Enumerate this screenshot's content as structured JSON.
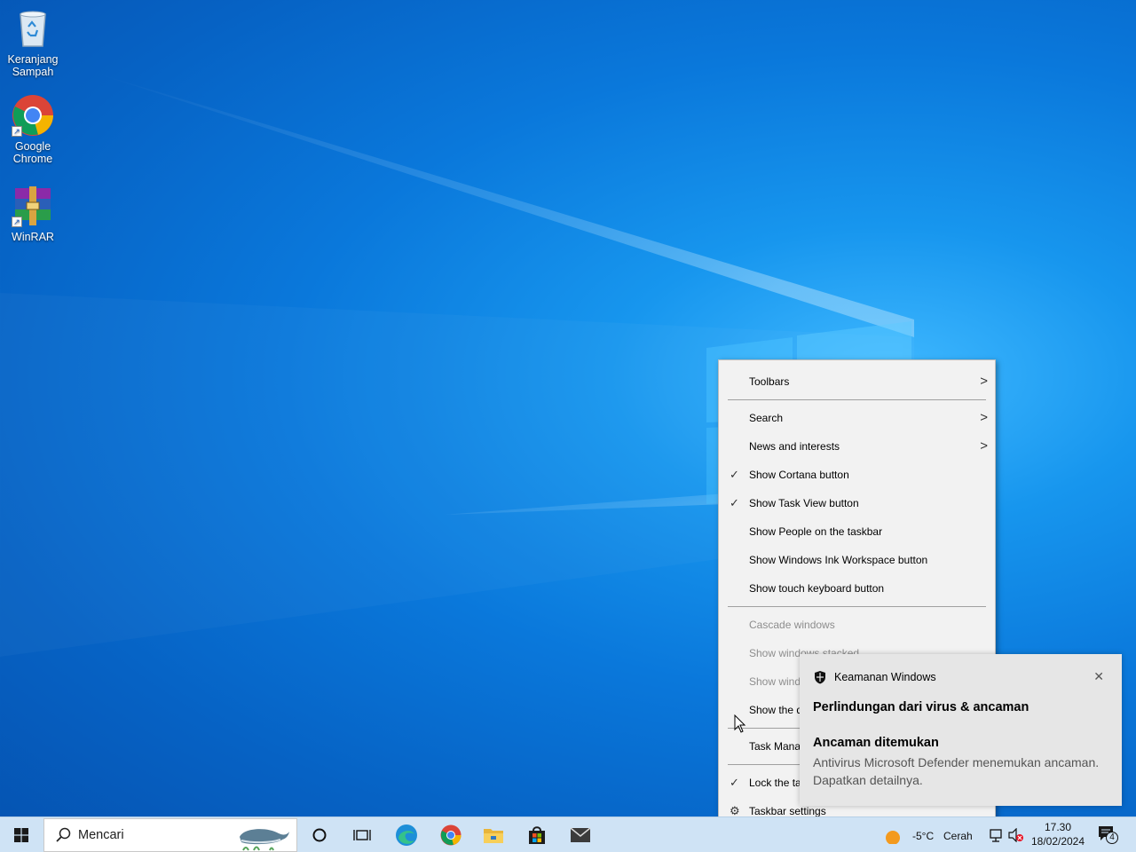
{
  "desktop": {
    "icons": [
      {
        "label": "Keranjang Sampah",
        "icon": "recycle-bin-icon"
      },
      {
        "label": "Google Chrome",
        "icon": "chrome-icon"
      },
      {
        "label": "WinRAR",
        "icon": "winrar-icon"
      }
    ]
  },
  "context_menu": {
    "items": [
      {
        "label": "Toolbars",
        "submenu": true,
        "checked": false,
        "enabled": true
      },
      {
        "label": "Search",
        "submenu": true,
        "checked": false,
        "enabled": true
      },
      {
        "label": "News and interests",
        "submenu": true,
        "checked": false,
        "enabled": true
      },
      {
        "label": "Show Cortana button",
        "submenu": false,
        "checked": true,
        "enabled": true
      },
      {
        "label": "Show Task View button",
        "submenu": false,
        "checked": true,
        "enabled": true
      },
      {
        "label": "Show People on the taskbar",
        "submenu": false,
        "checked": false,
        "enabled": true
      },
      {
        "label": "Show Windows Ink Workspace button",
        "submenu": false,
        "checked": false,
        "enabled": true
      },
      {
        "label": "Show touch keyboard button",
        "submenu": false,
        "checked": false,
        "enabled": true
      },
      {
        "label": "Cascade windows",
        "submenu": false,
        "checked": false,
        "enabled": false
      },
      {
        "label": "Show windows stacked",
        "submenu": false,
        "checked": false,
        "enabled": false
      },
      {
        "label": "Show windows side by side",
        "submenu": false,
        "checked": false,
        "enabled": false
      },
      {
        "label": "Show the desktop",
        "submenu": false,
        "checked": false,
        "enabled": true
      },
      {
        "label": "Task Manager",
        "submenu": false,
        "checked": false,
        "enabled": true
      },
      {
        "label": "Lock the taskbar",
        "submenu": false,
        "checked": true,
        "enabled": true
      },
      {
        "label": "Taskbar settings",
        "submenu": false,
        "checked": false,
        "enabled": true,
        "icon": "gear-icon"
      }
    ]
  },
  "toast": {
    "app_name": "Keamanan Windows",
    "heading": "Perlindungan dari virus & ancaman",
    "title": "Ancaman ditemukan",
    "body": "Antivirus Microsoft Defender menemukan ancaman. Dapatkan detailnya."
  },
  "taskbar": {
    "search_placeholder": "Mencari",
    "pinned": [
      "cortana-icon",
      "task-view-icon",
      "edge-icon",
      "chrome-icon",
      "file-explorer-icon",
      "store-icon",
      "mail-icon"
    ],
    "weather_temp": "-5°C",
    "weather_text": "Cerah",
    "time": "17.30",
    "date": "18/02/2024",
    "notification_count": "4"
  }
}
